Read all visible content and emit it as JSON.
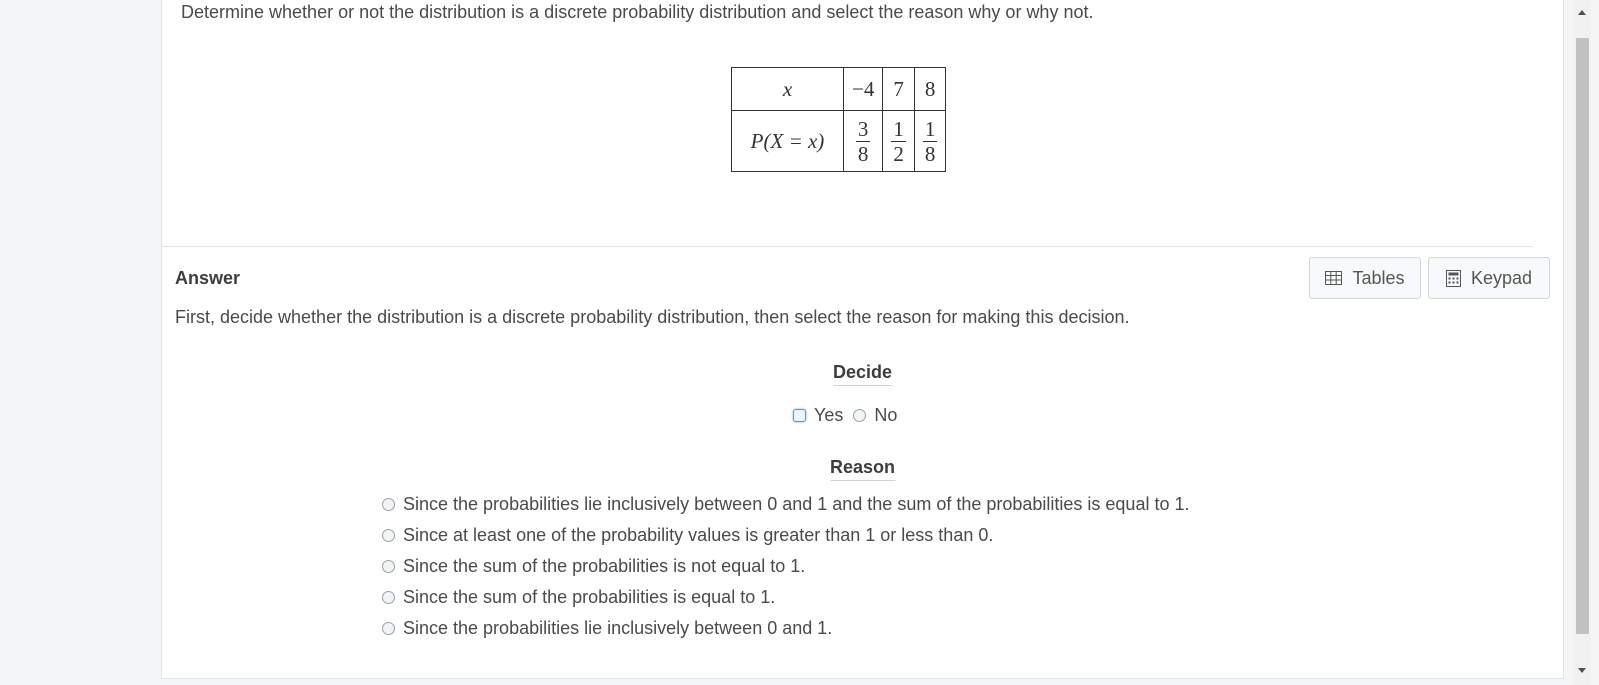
{
  "question": {
    "text": "Determine whether or not the distribution is a discrete probability distribution and select the reason why or why not."
  },
  "distribution_table": {
    "row_x_label": "x",
    "row_p_label": "P(X = x)",
    "x_values": [
      "−4",
      "7",
      "8"
    ],
    "probabilities": [
      {
        "num": "3",
        "den": "8"
      },
      {
        "num": "1",
        "den": "2"
      },
      {
        "num": "1",
        "den": "8"
      }
    ]
  },
  "answer": {
    "label": "Answer",
    "instruction": "First, decide whether the distribution is a discrete probability distribution, then select the reason for making this decision."
  },
  "toolbar": {
    "tables_label": "Tables",
    "keypad_label": "Keypad"
  },
  "decide": {
    "title": "Decide",
    "options": [
      "Yes",
      "No"
    ]
  },
  "reason": {
    "title": "Reason",
    "options": [
      "Since the probabilities lie inclusively between 0 and 1 and the sum of the probabilities is equal to 1.",
      "Since at least one of the probability values is greater than 1 or less than 0.",
      "Since the sum of the probabilities is not equal to 1.",
      "Since the sum of the probabilities is equal to 1.",
      "Since the probabilities lie inclusively between 0 and 1."
    ]
  }
}
